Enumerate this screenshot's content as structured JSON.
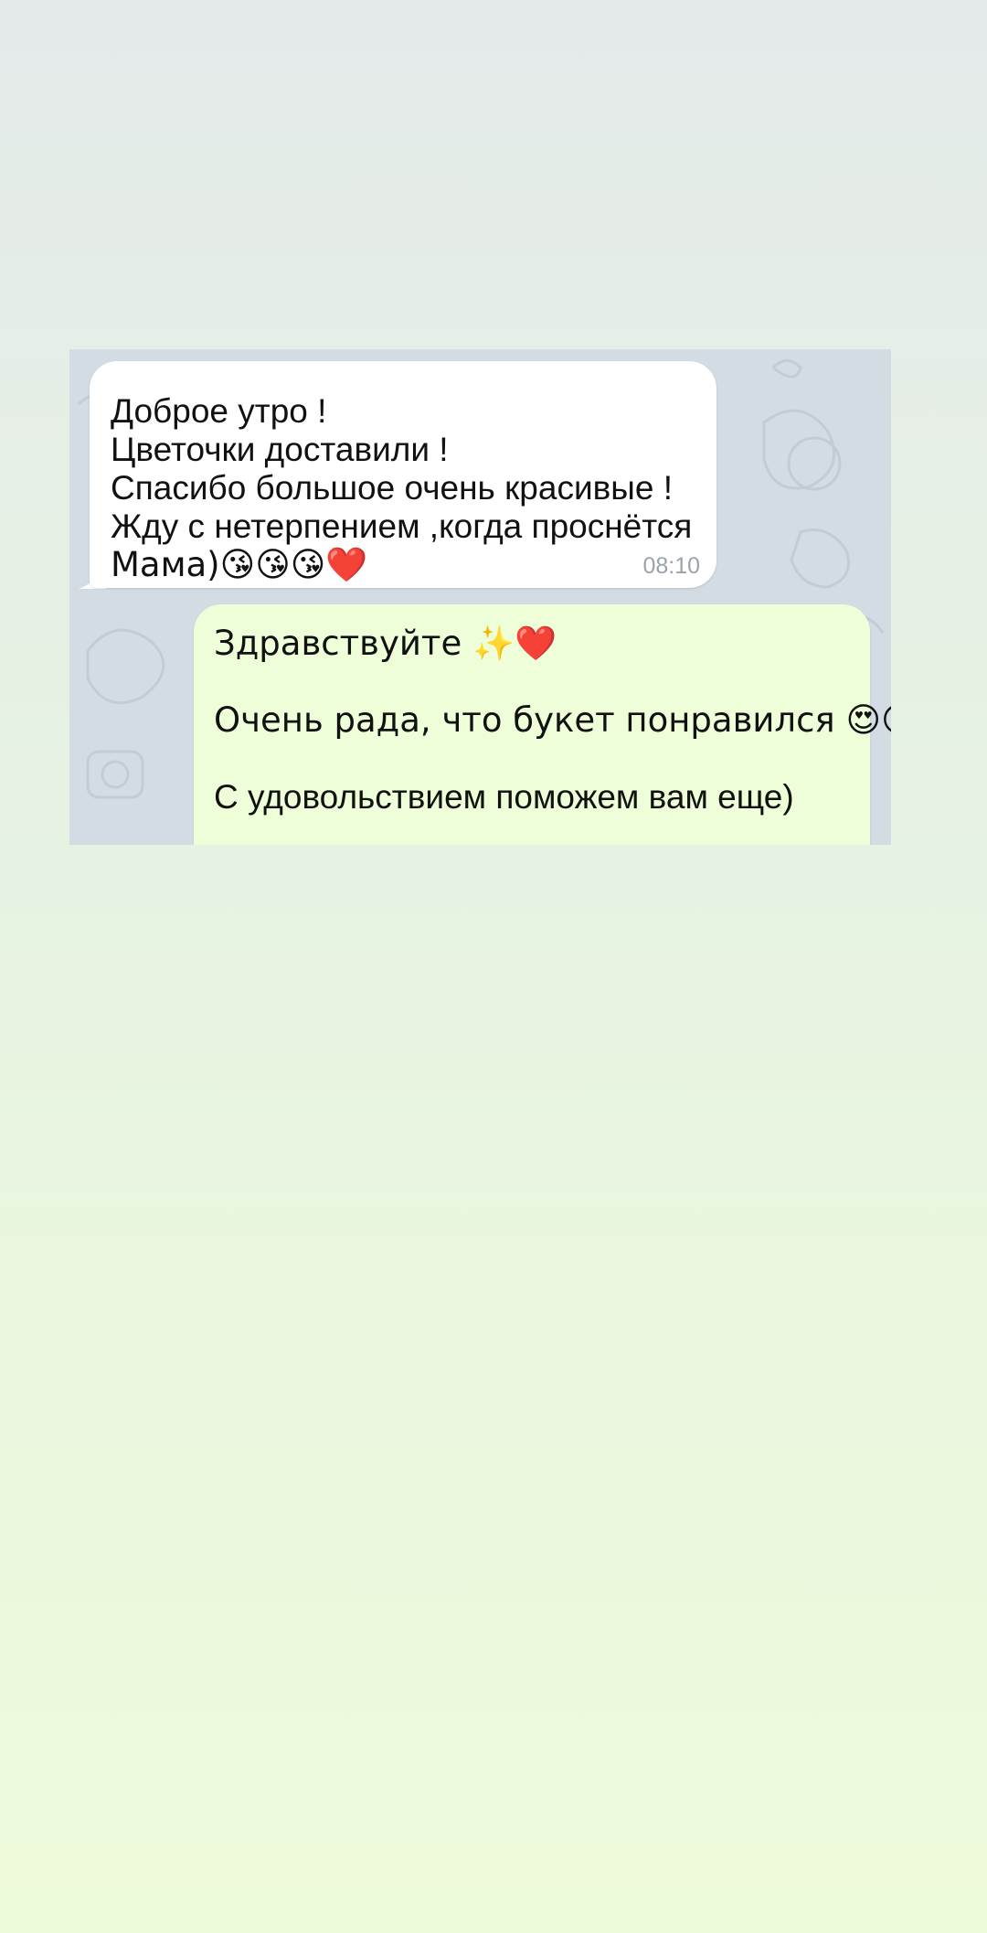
{
  "chat": {
    "incoming": {
      "lines": [
        "Доброе утро !",
        "Цветочки доставили !",
        "Спасибо большое очень красивые !",
        "Жду с нетерпением ,когда проснётся",
        "Мама)😘😘😘❤️"
      ],
      "time": "08:10",
      "bubble_color": "#ffffff"
    },
    "outgoing": {
      "lines": [
        "Здравствуйте ✨❤️",
        "Очень рада, что букет понравился 😍😘",
        "С удовольствием поможем вам еще)"
      ],
      "bubble_color": "#eefed8"
    }
  },
  "colors": {
    "wallpaper": "#d3dce3",
    "page_top": "#e4eaea",
    "page_bottom": "#eefbda",
    "time_text": "#9aa3ab"
  }
}
